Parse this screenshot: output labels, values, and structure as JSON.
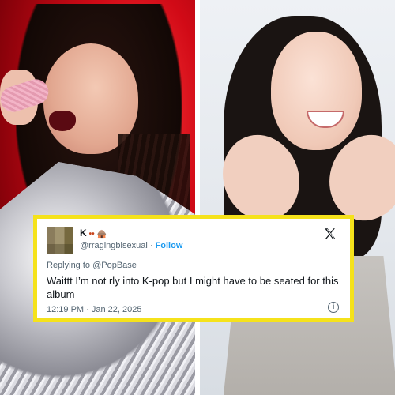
{
  "tweet": {
    "display_name": "K",
    "name_emoji": "•• 🛖",
    "handle": "@rragingbisexual",
    "separator": "·",
    "follow_label": "Follow",
    "replying_to": "Replying to @PopBase",
    "text": "Waittt I’m not rly into K-pop but I might have to be seated for this album",
    "timestamp": "12:19 PM · Jan 22, 2025",
    "platform_icon": "x-logo-icon",
    "info_icon": "info-icon"
  },
  "colors": {
    "card_border": "#f5e21b",
    "follow": "#1d9bf0",
    "left_background": "#d10a16",
    "right_background": "#e3e7ec"
  }
}
